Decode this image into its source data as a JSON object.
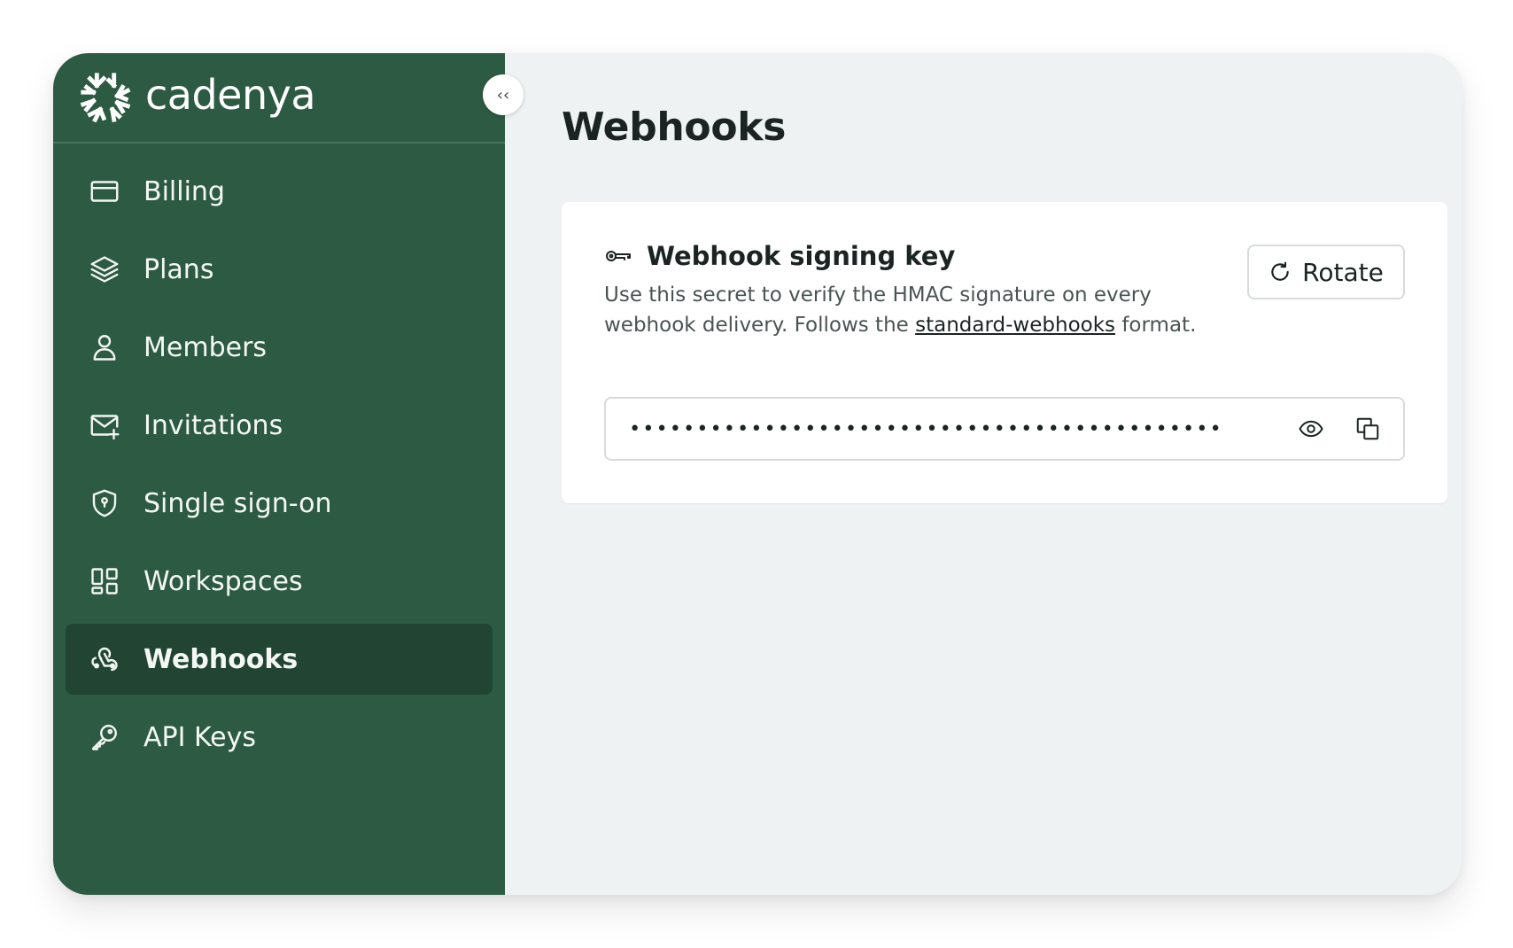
{
  "brand": {
    "name": "cadenya",
    "logo_icon": "snowflake-logo"
  },
  "sidebar": {
    "collapse_icon": "chevrons-left-icon",
    "collapse_label": "‹‹",
    "active_item": "Webhooks",
    "items": [
      {
        "label": "Billing",
        "icon": "credit-card-icon"
      },
      {
        "label": "Plans",
        "icon": "layers-icon"
      },
      {
        "label": "Members",
        "icon": "user-icon"
      },
      {
        "label": "Invitations",
        "icon": "mail-plus-icon"
      },
      {
        "label": "Single sign-on",
        "icon": "shield-icon"
      },
      {
        "label": "Workspaces",
        "icon": "layout-grid-icon"
      },
      {
        "label": "Webhooks",
        "icon": "webhook-icon"
      },
      {
        "label": "API Keys",
        "icon": "key-icon"
      }
    ]
  },
  "main": {
    "title": "Webhooks",
    "signing_key_card": {
      "title": "Webhook signing key",
      "icon": "key-outline-icon",
      "description_before": "Use this secret to verify the HMAC signature on every webhook delivery. Follows the ",
      "description_link": "standard-webhooks",
      "description_after": " format.",
      "rotate_label": "Rotate",
      "rotate_icon": "rotate-cw-icon",
      "secret_masked": "••••••••••••••••••••••••••••••••••••••••••••",
      "reveal_icon": "eye-icon",
      "copy_icon": "copy-icon"
    }
  },
  "colors": {
    "sidebar_bg": "#2d5a43",
    "sidebar_active_bg": "#214532",
    "main_bg": "#eef2f2",
    "card_bg": "#ffffff",
    "text_primary": "#1b2423"
  }
}
